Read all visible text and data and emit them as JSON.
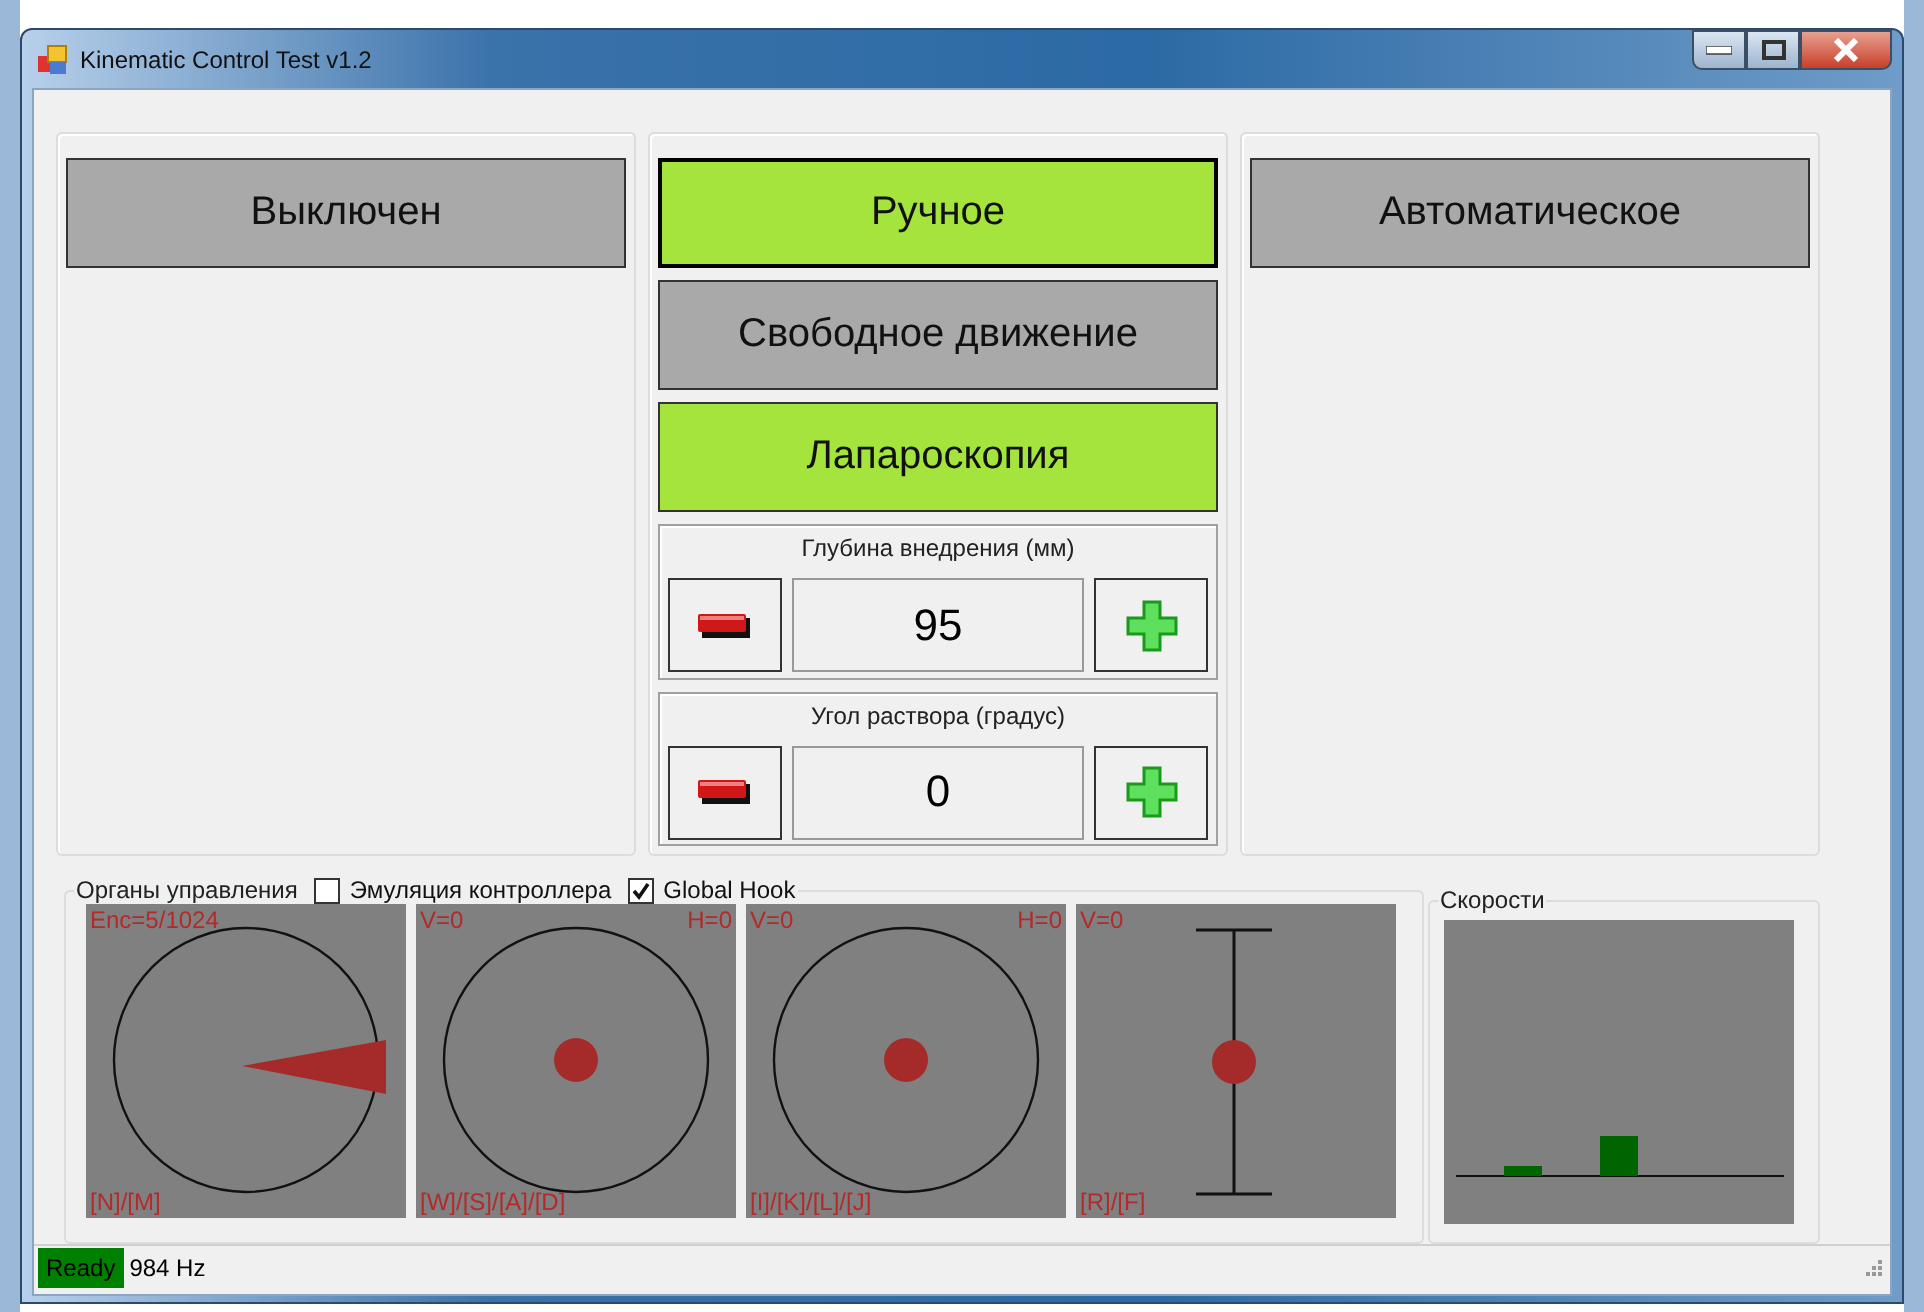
{
  "window": {
    "title": "Kinematic Control Test v1.2"
  },
  "panels": [
    {
      "buttons": [
        {
          "label": "Выключен",
          "selected": false,
          "focused": false
        }
      ]
    },
    {
      "buttons": [
        {
          "label": "Ручное",
          "selected": true,
          "focused": true
        },
        {
          "label": "Свободное движение",
          "selected": false,
          "focused": false
        },
        {
          "label": "Лапароскопия",
          "selected": true,
          "focused": false
        }
      ],
      "steppers": [
        {
          "label": "Глубина внедрения (мм)",
          "value": "95"
        },
        {
          "label": "Угол раствора (градус)",
          "value": "0"
        }
      ]
    },
    {
      "buttons": [
        {
          "label": "Автоматическое",
          "selected": false,
          "focused": false
        }
      ]
    }
  ],
  "controls": {
    "title": "Органы управления",
    "checkboxes": [
      {
        "label": "Эмуляция контроллера",
        "checked": false
      },
      {
        "label": "Global Hook",
        "checked": true
      }
    ],
    "panels": [
      {
        "kind": "encoder",
        "top_left": "Enc=5/1024",
        "bottom_left": "[N]/[M]"
      },
      {
        "kind": "stick",
        "top_left": "V=0",
        "top_right": "H=0",
        "bottom_left": "[W]/[S]/[A]/[D]"
      },
      {
        "kind": "stick",
        "top_left": "V=0",
        "top_right": "H=0",
        "bottom_left": "[I]/[K]/[L]/[J]"
      },
      {
        "kind": "slider",
        "top_left": "V=0",
        "bottom_left": "[R]/[F]"
      }
    ]
  },
  "speeds": {
    "title": "Скорости"
  },
  "status_bar": {
    "state": "Ready",
    "frequency": "984 Hz"
  }
}
